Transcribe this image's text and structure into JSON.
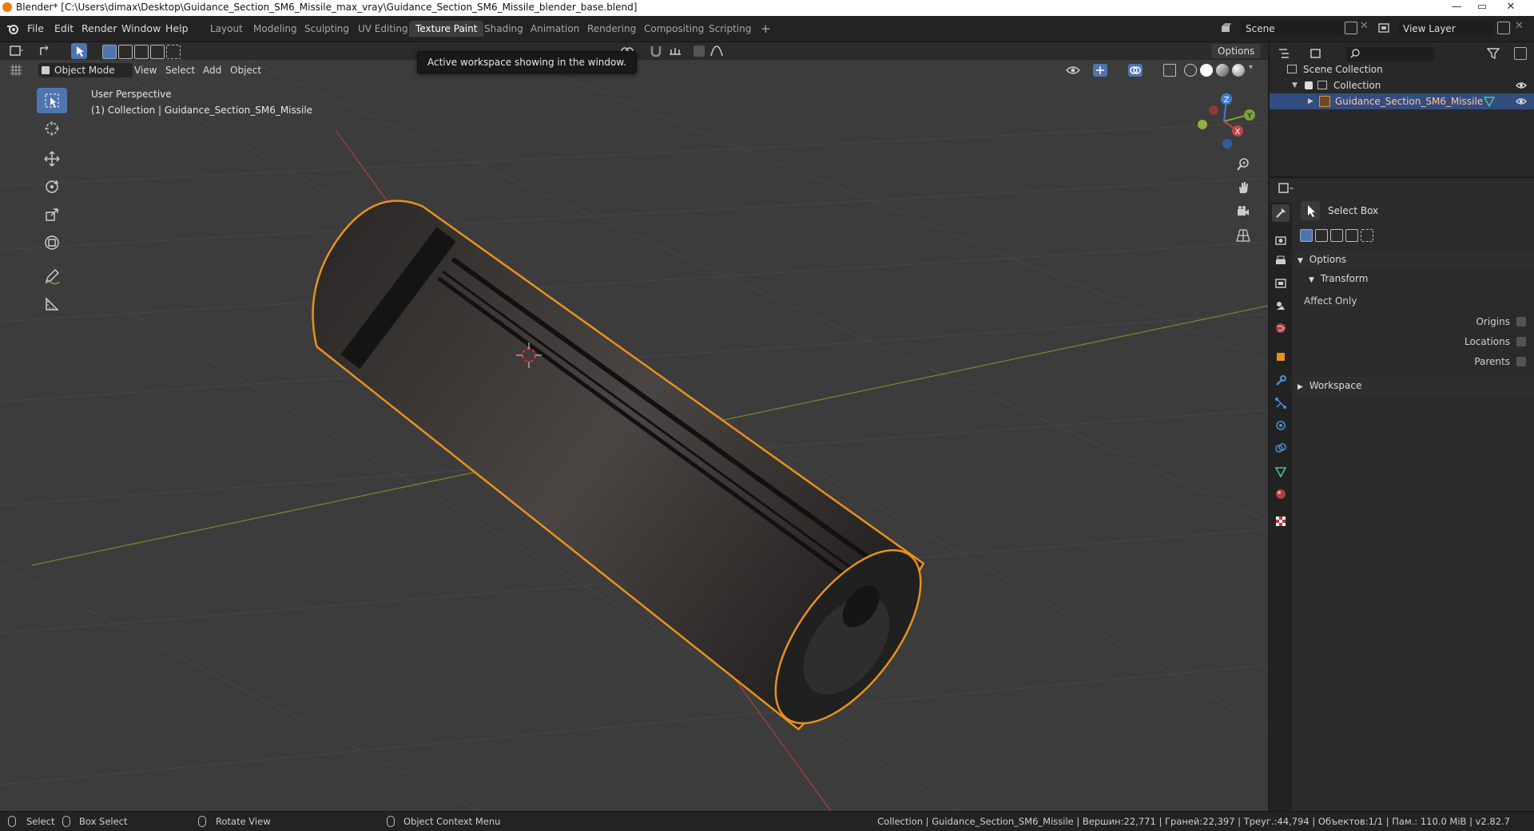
{
  "window": {
    "title": "Blender* [C:\\Users\\dimax\\Desktop\\Guidance_Section_SM6_Missile_max_vray\\Guidance_Section_SM6_Missile_blender_base.blend]",
    "minimize": "—",
    "maximize": "▭",
    "close": "✕"
  },
  "menu": [
    "File",
    "Edit",
    "Render",
    "Window",
    "Help"
  ],
  "workspaces": [
    {
      "label": "Layout",
      "active": false
    },
    {
      "label": "Modeling",
      "active": false
    },
    {
      "label": "Sculpting",
      "active": false
    },
    {
      "label": "UV Editing",
      "active": false
    },
    {
      "label": "Texture Paint",
      "active": true
    },
    {
      "label": "Shading",
      "active": false
    },
    {
      "label": "Animation",
      "active": false
    },
    {
      "label": "Rendering",
      "active": false
    },
    {
      "label": "Compositing",
      "active": false
    },
    {
      "label": "Scripting",
      "active": false
    }
  ],
  "add_workspace": "+",
  "scene": {
    "label": "Scene"
  },
  "view_layer": {
    "label": "View Layer"
  },
  "tooltip": "Active workspace showing in the window.",
  "viewport": {
    "mode": "Object Mode",
    "menus": [
      "View",
      "Select",
      "Add",
      "Object"
    ],
    "options": "Options",
    "perspective": "User Perspective",
    "collection_info": "(1) Collection | Guidance_Section_SM6_Missile",
    "gizmo": {
      "z": "Z",
      "y": "Y",
      "x": "X"
    }
  },
  "outliner": {
    "search_placeholder": "",
    "scene_collection": "Scene Collection",
    "collection": "Collection",
    "object": "Guidance_Section_SM6_Missile"
  },
  "properties": {
    "tool_name": "Select Box",
    "options_label": "Options",
    "transform_label": "Transform",
    "affect_only": "Affect Only",
    "origins": "Origins",
    "locations": "Locations",
    "parents": "Parents",
    "workspace_label": "Workspace"
  },
  "status": {
    "select": "Select",
    "box_select": "Box Select",
    "rotate_view": "Rotate View",
    "context_menu": "Object Context Menu",
    "stats": "Collection | Guidance_Section_SM6_Missile | Вершин:22,771 | Граней:22,397 | Треуг.:44,794 | Объектов:1/1 | Пам.: 110.0 MiB | v2.82.7"
  },
  "colors": {
    "accent": "#4f75b0",
    "selection_outline": "#e8911e",
    "active_tab": "#3d3d3d",
    "x_axis": "#c04646",
    "y_axis": "#7aa43a",
    "z_axis": "#3f7fd6"
  }
}
